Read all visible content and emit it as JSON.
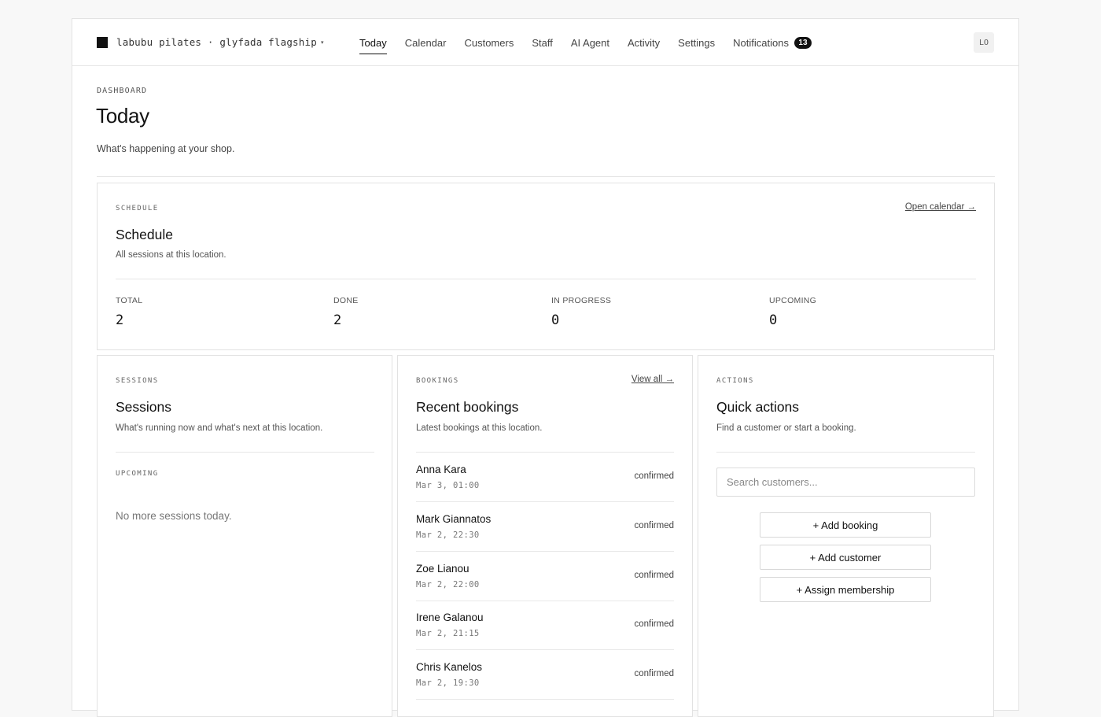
{
  "brand": {
    "name": "labubu pilates · glyfada flagship",
    "caret": "▾"
  },
  "nav": {
    "items": [
      {
        "label": "Today"
      },
      {
        "label": "Calendar"
      },
      {
        "label": "Customers"
      },
      {
        "label": "Staff"
      },
      {
        "label": "AI Agent"
      },
      {
        "label": "Activity"
      },
      {
        "label": "Settings"
      },
      {
        "label": "Notifications",
        "badge": "13"
      }
    ],
    "active": "Today",
    "avatar": "LO"
  },
  "page": {
    "eyebrow": "DASHBOARD",
    "title": "Today",
    "subtitle": "What's happening at your shop."
  },
  "schedule": {
    "eyebrow": "SCHEDULE",
    "title": "Schedule",
    "subtitle": "All sessions at this location.",
    "link": "Open calendar →",
    "stats": [
      {
        "label": "TOTAL",
        "value": "2"
      },
      {
        "label": "DONE",
        "value": "2"
      },
      {
        "label": "IN PROGRESS",
        "value": "0"
      },
      {
        "label": "UPCOMING",
        "value": "0"
      }
    ]
  },
  "sessions": {
    "eyebrow": "SESSIONS",
    "title": "Sessions",
    "subtitle": "What's running now and what's next at this location.",
    "upcoming_label": "UPCOMING",
    "empty": "No more sessions today."
  },
  "bookings": {
    "eyebrow": "BOOKINGS",
    "title": "Recent bookings",
    "subtitle": "Latest bookings at this location.",
    "link": "View all →",
    "items": [
      {
        "name": "Anna Kara",
        "time": "Mar 3, 01:00",
        "status": "confirmed"
      },
      {
        "name": "Mark Giannatos",
        "time": "Mar 2, 22:30",
        "status": "confirmed"
      },
      {
        "name": "Zoe Lianou",
        "time": "Mar 2, 22:00",
        "status": "confirmed"
      },
      {
        "name": "Irene Galanou",
        "time": "Mar 2, 21:15",
        "status": "confirmed"
      },
      {
        "name": "Chris Kanelos",
        "time": "Mar 2, 19:30",
        "status": "confirmed"
      }
    ]
  },
  "actions": {
    "eyebrow": "ACTIONS",
    "title": "Quick actions",
    "subtitle": "Find a customer or start a booking.",
    "search_placeholder": "Search customers...",
    "add_booking": "+ Add booking",
    "add_customer": "+ Add customer",
    "assign_membership": "+ Assign membership"
  }
}
